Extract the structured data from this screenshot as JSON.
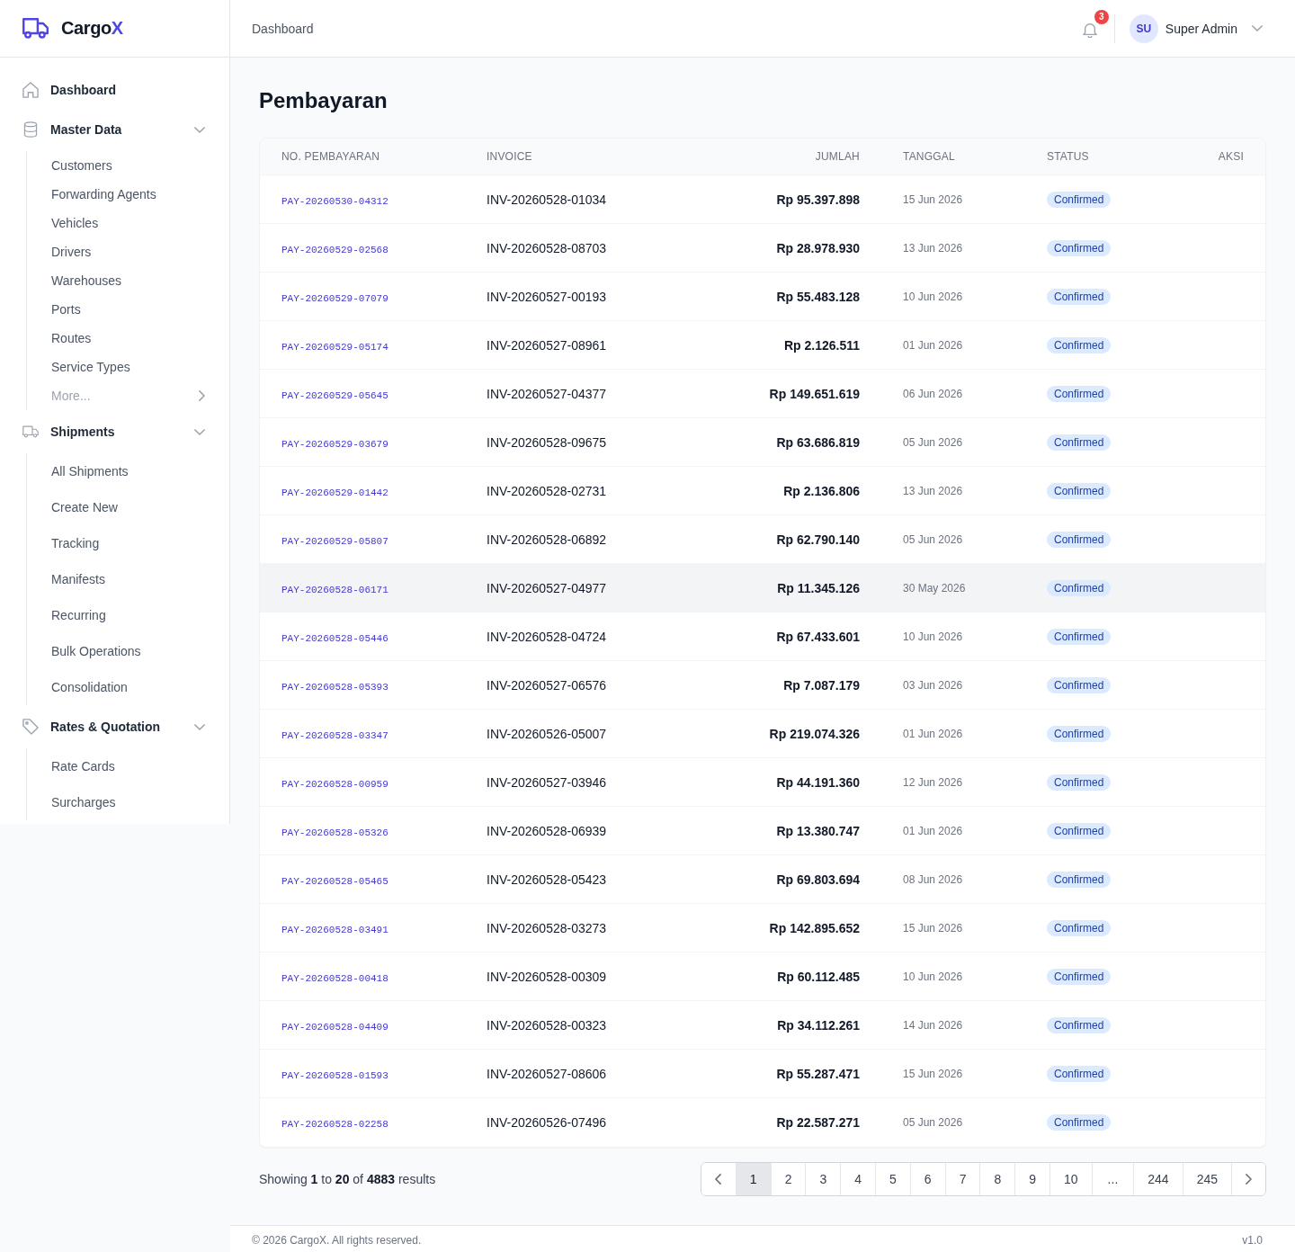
{
  "sidebar": {
    "logo": {
      "text": "Cargo",
      "accent": "X"
    },
    "items": [
      {
        "kind": "link",
        "label": "Dashboard"
      },
      {
        "kind": "group",
        "label": "Master Data",
        "expanded": true,
        "dense": true,
        "children": [
          {
            "kind": "link",
            "label": "Customers"
          },
          {
            "kind": "link",
            "label": "Forwarding Agents"
          },
          {
            "kind": "link",
            "label": "Vehicles"
          },
          {
            "kind": "link",
            "label": "Drivers"
          },
          {
            "kind": "link",
            "label": "Warehouses"
          },
          {
            "kind": "link",
            "label": "Ports"
          },
          {
            "kind": "link",
            "label": "Routes"
          },
          {
            "kind": "link",
            "label": "Service Types"
          },
          {
            "kind": "more",
            "label": "More..."
          }
        ]
      },
      {
        "kind": "group",
        "label": "Shipments",
        "expanded": true,
        "dense": false,
        "children": [
          {
            "kind": "link",
            "label": "All Shipments"
          },
          {
            "kind": "link",
            "label": "Create New"
          },
          {
            "kind": "link",
            "label": "Tracking"
          },
          {
            "kind": "link",
            "label": "Manifests"
          },
          {
            "kind": "link",
            "label": "Recurring"
          },
          {
            "kind": "link",
            "label": "Bulk Operations"
          },
          {
            "kind": "link",
            "label": "Consolidation"
          }
        ]
      },
      {
        "kind": "group",
        "label": "Rates & Quotation",
        "expanded": true,
        "dense": false,
        "children": [
          {
            "kind": "link",
            "label": "Rate Cards"
          },
          {
            "kind": "link",
            "label": "Surcharges"
          }
        ]
      }
    ]
  },
  "top_bar": {
    "breadcrumb": "Dashboard",
    "notifications": {
      "count": "3"
    },
    "user": {
      "initials": "SU",
      "name": "Super Admin"
    }
  },
  "page": {
    "title": "Pembayaran",
    "table": {
      "columns": [
        "NO. PEMBAYARAN",
        "INVOICE",
        "JUMLAH",
        "TANGGAL",
        "STATUS",
        "AKSI"
      ],
      "rows": [
        {
          "payment_no": "PAY-20260530-04312",
          "invoice": "INV-20260528-01034",
          "amount": "Rp 95.397.898",
          "date": "15 Jun 2026",
          "status": "Confirmed",
          "highlighted": false
        },
        {
          "payment_no": "PAY-20260529-02568",
          "invoice": "INV-20260528-08703",
          "amount": "Rp 28.978.930",
          "date": "13 Jun 2026",
          "status": "Confirmed",
          "highlighted": false
        },
        {
          "payment_no": "PAY-20260529-07079",
          "invoice": "INV-20260527-00193",
          "amount": "Rp 55.483.128",
          "date": "10 Jun 2026",
          "status": "Confirmed",
          "highlighted": false
        },
        {
          "payment_no": "PAY-20260529-05174",
          "invoice": "INV-20260527-08961",
          "amount": "Rp 2.126.511",
          "date": "01 Jun 2026",
          "status": "Confirmed",
          "highlighted": false
        },
        {
          "payment_no": "PAY-20260529-05645",
          "invoice": "INV-20260527-04377",
          "amount": "Rp 149.651.619",
          "date": "06 Jun 2026",
          "status": "Confirmed",
          "highlighted": false
        },
        {
          "payment_no": "PAY-20260529-03679",
          "invoice": "INV-20260528-09675",
          "amount": "Rp 63.686.819",
          "date": "05 Jun 2026",
          "status": "Confirmed",
          "highlighted": false
        },
        {
          "payment_no": "PAY-20260529-01442",
          "invoice": "INV-20260528-02731",
          "amount": "Rp 2.136.806",
          "date": "13 Jun 2026",
          "status": "Confirmed",
          "highlighted": false
        },
        {
          "payment_no": "PAY-20260529-05807",
          "invoice": "INV-20260528-06892",
          "amount": "Rp 62.790.140",
          "date": "05 Jun 2026",
          "status": "Confirmed",
          "highlighted": false
        },
        {
          "payment_no": "PAY-20260528-06171",
          "invoice": "INV-20260527-04977",
          "amount": "Rp 11.345.126",
          "date": "30 May 2026",
          "status": "Confirmed",
          "highlighted": true
        },
        {
          "payment_no": "PAY-20260528-05446",
          "invoice": "INV-20260528-04724",
          "amount": "Rp 67.433.601",
          "date": "10 Jun 2026",
          "status": "Confirmed",
          "highlighted": false
        },
        {
          "payment_no": "PAY-20260528-05393",
          "invoice": "INV-20260527-06576",
          "amount": "Rp 7.087.179",
          "date": "03 Jun 2026",
          "status": "Confirmed",
          "highlighted": false
        },
        {
          "payment_no": "PAY-20260528-03347",
          "invoice": "INV-20260526-05007",
          "amount": "Rp 219.074.326",
          "date": "01 Jun 2026",
          "status": "Confirmed",
          "highlighted": false
        },
        {
          "payment_no": "PAY-20260528-00959",
          "invoice": "INV-20260527-03946",
          "amount": "Rp 44.191.360",
          "date": "12 Jun 2026",
          "status": "Confirmed",
          "highlighted": false
        },
        {
          "payment_no": "PAY-20260528-05326",
          "invoice": "INV-20260528-06939",
          "amount": "Rp 13.380.747",
          "date": "01 Jun 2026",
          "status": "Confirmed",
          "highlighted": false
        },
        {
          "payment_no": "PAY-20260528-05465",
          "invoice": "INV-20260528-05423",
          "amount": "Rp 69.803.694",
          "date": "08 Jun 2026",
          "status": "Confirmed",
          "highlighted": false
        },
        {
          "payment_no": "PAY-20260528-03491",
          "invoice": "INV-20260528-03273",
          "amount": "Rp 142.895.652",
          "date": "15 Jun 2026",
          "status": "Confirmed",
          "highlighted": false
        },
        {
          "payment_no": "PAY-20260528-00418",
          "invoice": "INV-20260528-00309",
          "amount": "Rp 60.112.485",
          "date": "10 Jun 2026",
          "status": "Confirmed",
          "highlighted": false
        },
        {
          "payment_no": "PAY-20260528-04409",
          "invoice": "INV-20260528-00323",
          "amount": "Rp 34.112.261",
          "date": "14 Jun 2026",
          "status": "Confirmed",
          "highlighted": false
        },
        {
          "payment_no": "PAY-20260528-01593",
          "invoice": "INV-20260527-08606",
          "amount": "Rp 55.287.471",
          "date": "15 Jun 2026",
          "status": "Confirmed",
          "highlighted": false
        },
        {
          "payment_no": "PAY-20260528-02258",
          "invoice": "INV-20260526-07496",
          "amount": "Rp 22.587.271",
          "date": "05 Jun 2026",
          "status": "Confirmed",
          "highlighted": false
        }
      ]
    },
    "pagination": {
      "summary": "Showing **1** to **20** of **4883** results",
      "pages": [
        {
          "kind": "page",
          "label": "1",
          "selected": true
        },
        {
          "kind": "page",
          "label": "2",
          "selected": false
        },
        {
          "kind": "page",
          "label": "3",
          "selected": false
        },
        {
          "kind": "page",
          "label": "4",
          "selected": false
        },
        {
          "kind": "page",
          "label": "5",
          "selected": false
        },
        {
          "kind": "page",
          "label": "6",
          "selected": false
        },
        {
          "kind": "page",
          "label": "7",
          "selected": false
        },
        {
          "kind": "page",
          "label": "8",
          "selected": false
        },
        {
          "kind": "page",
          "label": "9",
          "selected": false
        },
        {
          "kind": "page",
          "label": "10",
          "selected": false
        },
        {
          "kind": "gap",
          "label": "..."
        },
        {
          "kind": "page",
          "label": "244",
          "selected": false
        },
        {
          "kind": "page",
          "label": "245",
          "selected": false
        }
      ]
    }
  },
  "footer": {
    "copyright": "© 2026 CargoX. All rights reserved.",
    "version": "v1.0"
  }
}
